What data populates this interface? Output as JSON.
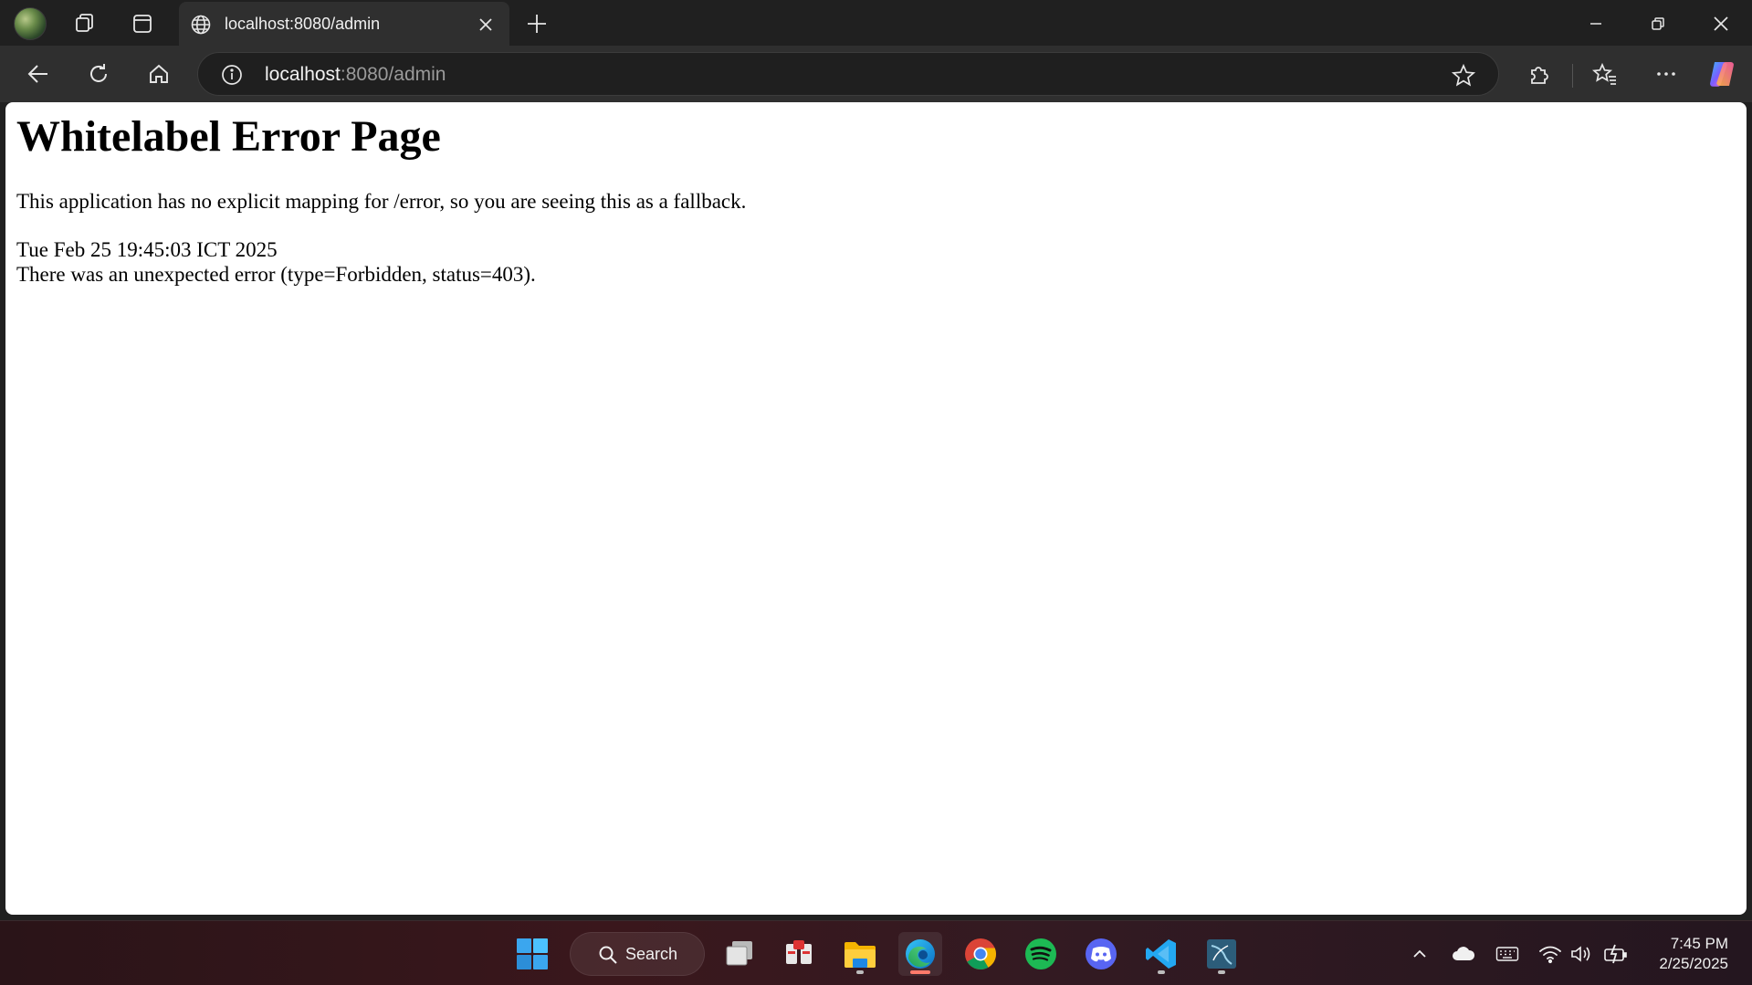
{
  "browser": {
    "tab_title": "localhost:8080/admin",
    "url_host": "localhost",
    "url_path": ":8080/admin"
  },
  "page": {
    "heading": "Whitelabel Error Page",
    "message": "This application has no explicit mapping for /error, so you are seeing this as a fallback.",
    "timestamp": "Tue Feb 25 19:45:03 ICT 2025",
    "error": "There was an unexpected error (type=Forbidden, status=403)."
  },
  "taskbar": {
    "search_label": "Search",
    "apps": [
      "start-icon",
      "task-view-icon",
      "app-icon",
      "file-explorer-icon",
      "edge-icon",
      "chrome-icon",
      "spotify-icon",
      "discord-icon",
      "vscode-icon",
      "mysql-workbench-icon"
    ],
    "active_app": "edge-icon"
  },
  "clock": {
    "time": "7:45 PM",
    "date": "2/25/2025"
  },
  "colors": {
    "edge_active": "#ff7a6a",
    "spotify": "#1db954",
    "discord": "#5865f2",
    "vscode": "#23a8f2"
  }
}
